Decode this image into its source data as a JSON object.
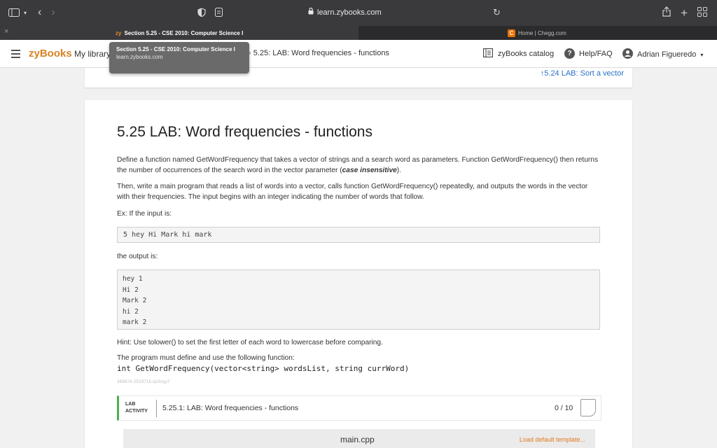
{
  "browser": {
    "address": "learn.zybooks.com",
    "tabs": [
      {
        "prefix": "zy",
        "title": "Section 5.25 - CSE 2010: Computer Science I"
      },
      {
        "icon": "C",
        "title": "Home | Chegg.com"
      }
    ],
    "tab_close": "×"
  },
  "tooltip": {
    "title": "Section 5.25 - CSE 2010: Computer Science I",
    "url": "learn.zybooks.com"
  },
  "header": {
    "logo": "zyBooks",
    "my_library": "My library",
    "breadcrumb": "5.25: LAB: Word frequencies - functions",
    "catalog": "zyBooks catalog",
    "help": "Help/FAQ",
    "user": "Adrian Figueredo"
  },
  "prev_section": {
    "link": "5.24 LAB: Sort a vector"
  },
  "section": {
    "title": "5.25 LAB: Word frequencies - functions",
    "para1_a": "Define a function named GetWordFrequency that takes a vector of strings and a search word as parameters. Function GetWordFrequency() then returns the number of occurrences of the search word in the vector parameter (",
    "para1_em": "case insensitive",
    "para1_b": ").",
    "para2": "Then, write a main program that reads a list of words into a vector, calls function GetWordFrequency() repeatedly, and outputs the words in the vector with their frequencies. The input begins with an integer indicating the number of words that follow.",
    "para3": "Ex: If the input is:",
    "input_example": "5 hey Hi Mark hi mark",
    "para4": "the output is:",
    "output_lines": [
      "hey 1",
      "Hi 2",
      "Mark 2",
      "hi 2",
      "mark 2"
    ],
    "hint": "Hint: Use tolower() to set the first letter of each word to lowercase before comparing.",
    "must_define": "The program must define and use the following function:",
    "signature": "int GetWordFrequency(vector<string> wordsList, string currWord)",
    "tiny_id": "369974.2529716.qx3zqy7"
  },
  "lab": {
    "badge_line1": "LAB",
    "badge_line2": "ACTIVITY",
    "title": "5.25.1: LAB: Word frequencies - functions",
    "score": "0 / 10",
    "file": "main.cpp",
    "load_template": "Load default template..."
  }
}
